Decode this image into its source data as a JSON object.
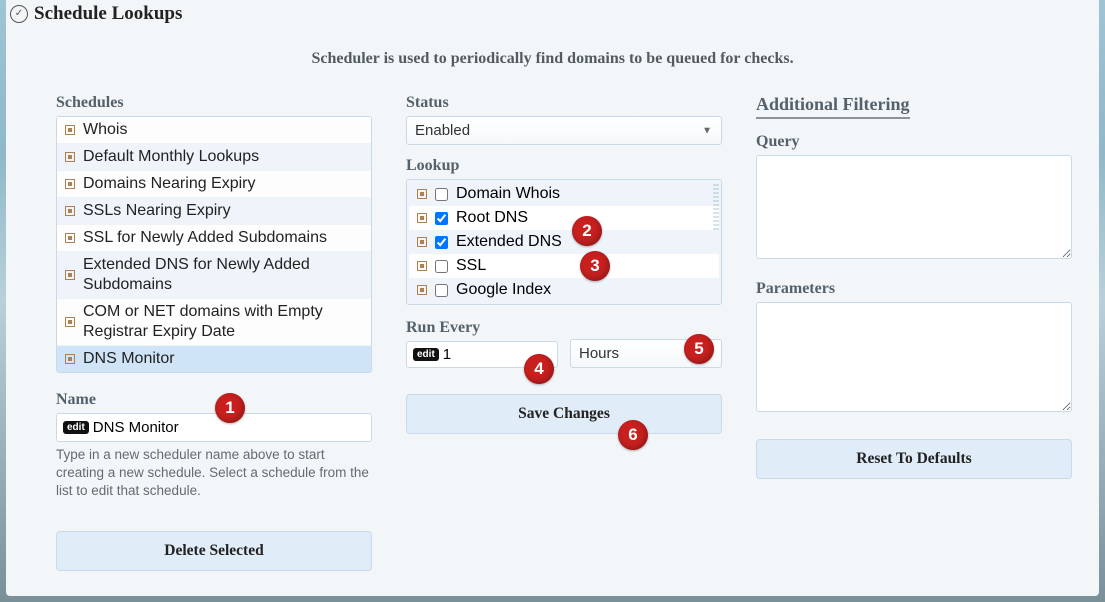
{
  "header": {
    "title": "Schedule Lookups",
    "description": "Scheduler is used to periodically find domains to be queued for checks."
  },
  "left": {
    "schedules_label": "Schedules",
    "schedules": [
      "Whois",
      "Default Monthly Lookups",
      "Domains Nearing Expiry",
      "SSLs Nearing Expiry",
      "SSL for Newly Added Subdomains",
      "Extended DNS for Newly Added Subdomains",
      "COM or NET domains with Empty Registrar Expiry Date",
      "DNS Monitor"
    ],
    "selected_index": 7,
    "name_label": "Name",
    "edit_badge": "edit",
    "name_value": "DNS Monitor",
    "name_helper": "Type in a new scheduler name above to start creating a new schedule. Select a schedule from the list to edit that schedule.",
    "delete_button": "Delete Selected"
  },
  "mid": {
    "status_label": "Status",
    "status_value": "Enabled",
    "lookup_label": "Lookup",
    "lookups": [
      {
        "label": "Domain Whois",
        "checked": false
      },
      {
        "label": "Root DNS",
        "checked": true
      },
      {
        "label": "Extended DNS",
        "checked": true
      },
      {
        "label": "SSL",
        "checked": false
      },
      {
        "label": "Google Index",
        "checked": false
      }
    ],
    "run_every_label": "Run Every",
    "edit_badge": "edit",
    "run_value": "1",
    "run_unit": "Hours",
    "save_button": "Save Changes"
  },
  "right": {
    "heading": "Additional Filtering",
    "query_label": "Query",
    "query_value": "",
    "params_label": "Parameters",
    "params_value": "",
    "reset_button": "Reset To Defaults"
  },
  "markers": {
    "1": "1",
    "2": "2",
    "3": "3",
    "4": "4",
    "5": "5",
    "6": "6"
  }
}
